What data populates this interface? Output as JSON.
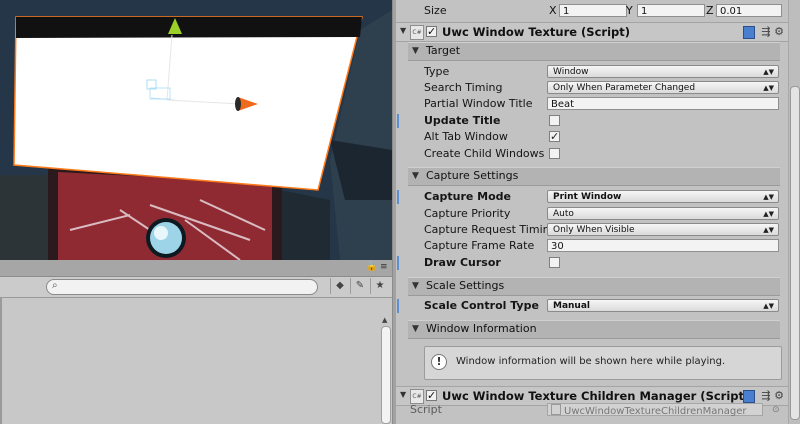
{
  "transform_size": {
    "label": "Size",
    "x_label": "X",
    "x_value": "1",
    "y_label": "Y",
    "y_value": "1",
    "z_label": "Z",
    "z_value": "0.01"
  },
  "component": {
    "title": "Uwc Window Texture (Script)",
    "enabled": true,
    "icons": {
      "help": "book-help-icon",
      "preset": "preset-sliders-icon",
      "settings": "gear-icon"
    }
  },
  "target_section": {
    "title": "Target",
    "type": {
      "label": "Type",
      "value": "Window"
    },
    "search_timing": {
      "label": "Search Timing",
      "value": "Only When Parameter Changed"
    },
    "partial_window_title": {
      "label": "Partial Window Title",
      "value": "Beat"
    },
    "update_title": {
      "label": "Update Title",
      "checked": false
    },
    "alt_tab_window": {
      "label": "Alt Tab Window",
      "checked": true
    },
    "create_child_windows": {
      "label": "Create Child Windows",
      "checked": false
    }
  },
  "capture_section": {
    "title": "Capture Settings",
    "capture_mode": {
      "label": "Capture Mode",
      "value": "Print Window"
    },
    "capture_priority": {
      "label": "Capture Priority",
      "value": "Auto"
    },
    "capture_request_timing": {
      "label": "Capture Request Timing",
      "value": "Only When Visible"
    },
    "capture_frame_rate": {
      "label": "Capture Frame Rate",
      "value": "30"
    },
    "draw_cursor": {
      "label": "Draw Cursor",
      "checked": false
    }
  },
  "scale_section": {
    "title": "Scale Settings",
    "scale_control_type": {
      "label": "Scale Control Type",
      "value": "Manual"
    }
  },
  "window_info_section": {
    "title": "Window Information",
    "message": "Window information will be shown here while playing."
  },
  "children_manager": {
    "title": "Uwc Window Texture Children Manager (Script)",
    "enabled": true,
    "script_label": "Script",
    "script_value": "UwcWindowTextureChildrenManager"
  },
  "colors": {
    "selection_outline": "#ff7a1a",
    "gizmo_y": "#9ad028",
    "gizmo_x": "#f06a1c",
    "inspector_bg": "#c2c2c2"
  },
  "project_panel": {
    "search_placeholder": ""
  }
}
